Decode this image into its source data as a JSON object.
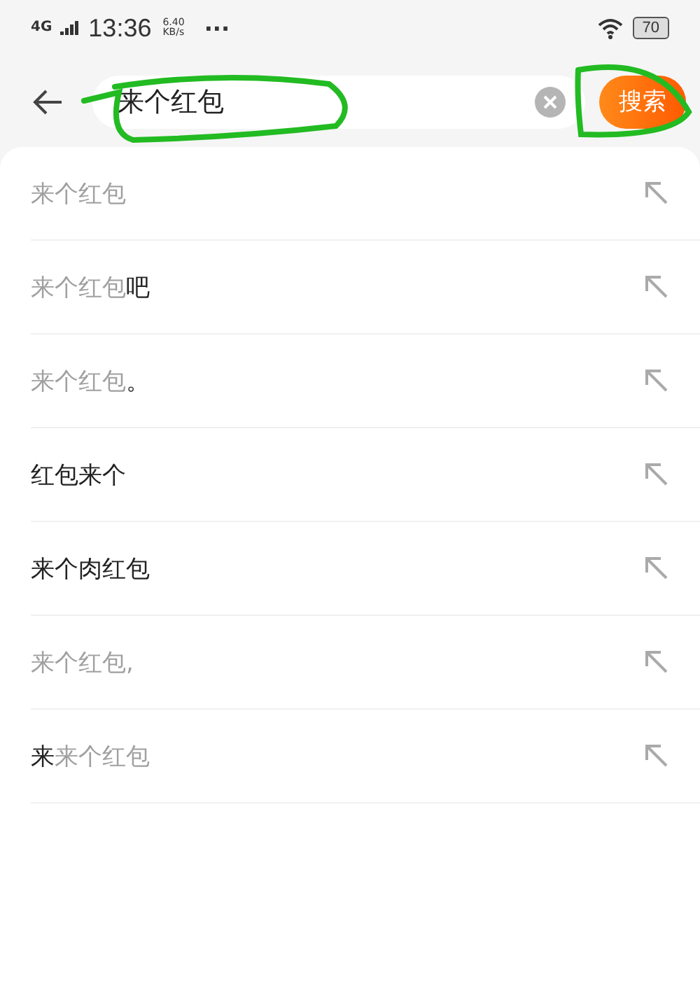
{
  "status_bar": {
    "network": "4G",
    "time": "13:36",
    "speed": "6.40",
    "speed_unit": "KB/s",
    "more": "···",
    "battery": "70"
  },
  "search": {
    "value": "来个红包",
    "button": "搜索"
  },
  "suggestions": [
    {
      "parts": [
        {
          "text": "来个红包",
          "matched": true
        }
      ]
    },
    {
      "parts": [
        {
          "text": "来个红包",
          "matched": true
        },
        {
          "text": "吧",
          "matched": false
        }
      ]
    },
    {
      "parts": [
        {
          "text": "来个红包",
          "matched": true
        },
        {
          "text": "。",
          "matched": false
        }
      ]
    },
    {
      "parts": [
        {
          "text": "红包来个",
          "matched": false
        }
      ]
    },
    {
      "parts": [
        {
          "text": "来个肉红包",
          "matched": false
        }
      ]
    },
    {
      "parts": [
        {
          "text": "来个红包,",
          "matched": true
        }
      ]
    },
    {
      "parts": [
        {
          "text": "来",
          "matched": false
        },
        {
          "text": "来个红包",
          "matched": true
        }
      ]
    }
  ]
}
